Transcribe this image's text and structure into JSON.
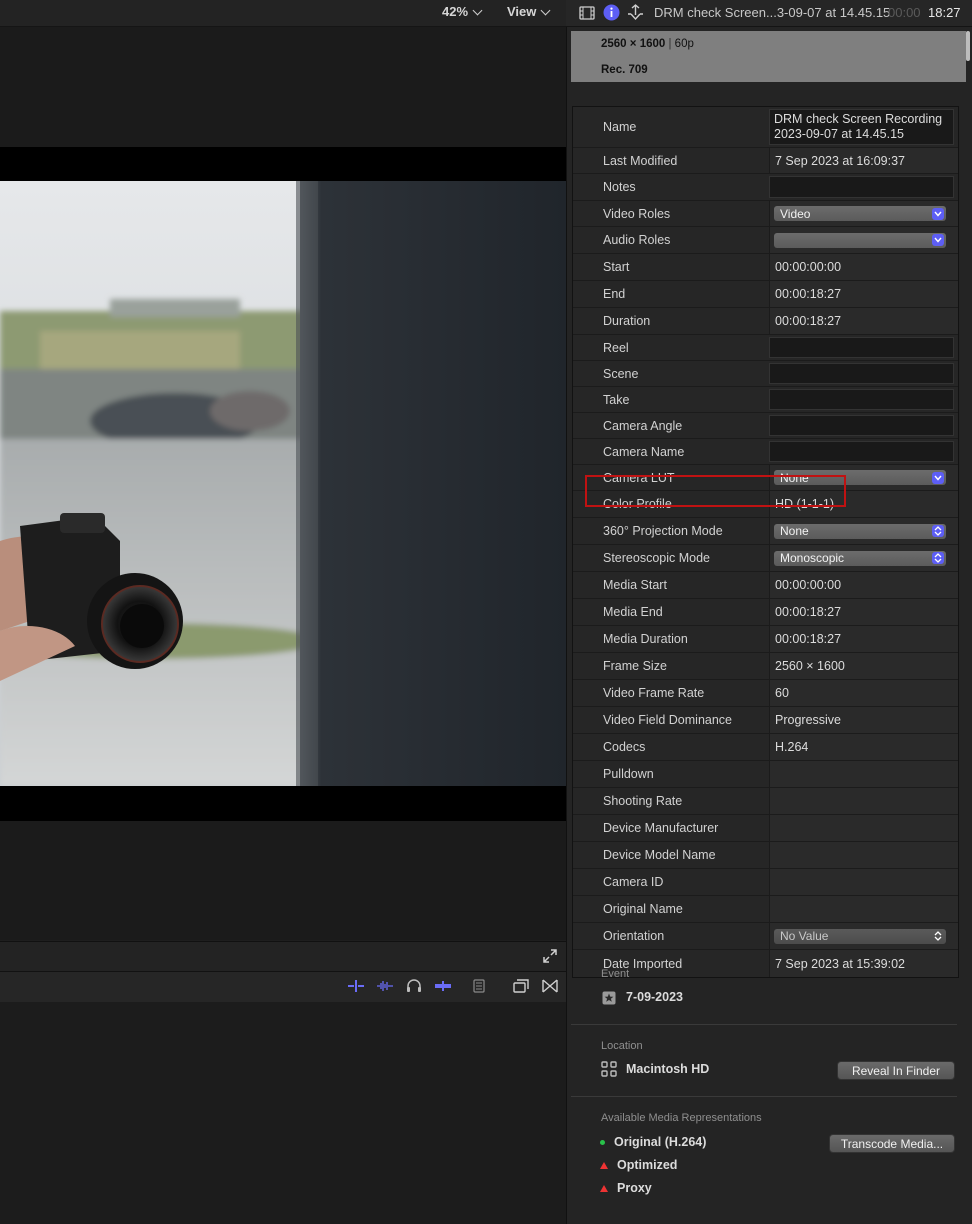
{
  "viewer": {
    "zoom_label": "42%",
    "view_label": "View"
  },
  "inspector": {
    "clip_title": "DRM check Screen...3-09-07 at 14.45.15",
    "timecode_dim": "00:00",
    "timecode": "18:27",
    "summary": {
      "resolution": "2560 × 1600",
      "fps": "60p",
      "color_space": "Rec. 709"
    },
    "rows": [
      {
        "label": "Name",
        "value": "DRM check Screen Recording 2023-09-07 at 14.45.15",
        "kind": "field"
      },
      {
        "label": "Last Modified",
        "value": "7 Sep 2023 at 16:09:37",
        "kind": "text"
      },
      {
        "label": "Notes",
        "value": "",
        "kind": "field"
      },
      {
        "label": "Video Roles",
        "value": "Video",
        "kind": "popup"
      },
      {
        "label": "Audio Roles",
        "value": "",
        "kind": "popup"
      },
      {
        "label": "Start",
        "value": "00:00:00:00",
        "kind": "text"
      },
      {
        "label": "End",
        "value": "00:00:18:27",
        "kind": "text"
      },
      {
        "label": "Duration",
        "value": "00:00:18:27",
        "kind": "text"
      },
      {
        "label": "Reel",
        "value": "",
        "kind": "field"
      },
      {
        "label": "Scene",
        "value": "",
        "kind": "field"
      },
      {
        "label": "Take",
        "value": "",
        "kind": "field"
      },
      {
        "label": "Camera Angle",
        "value": "",
        "kind": "field"
      },
      {
        "label": "Camera Name",
        "value": "",
        "kind": "field"
      },
      {
        "label": "Camera LUT",
        "value": "None",
        "kind": "popup"
      },
      {
        "label": "Color Profile",
        "value": "HD (1-1-1)",
        "kind": "text"
      },
      {
        "label": "360° Projection Mode",
        "value": "None",
        "kind": "popup"
      },
      {
        "label": "Stereoscopic Mode",
        "value": "Monoscopic",
        "kind": "popup"
      },
      {
        "label": "Media Start",
        "value": "00:00:00:00",
        "kind": "text"
      },
      {
        "label": "Media End",
        "value": "00:00:18:27",
        "kind": "text"
      },
      {
        "label": "Media Duration",
        "value": "00:00:18:27",
        "kind": "text"
      },
      {
        "label": "Frame Size",
        "value": "2560 × 1600",
        "kind": "text"
      },
      {
        "label": "Video Frame Rate",
        "value": "60",
        "kind": "text"
      },
      {
        "label": "Video Field Dominance",
        "value": "Progressive",
        "kind": "text"
      },
      {
        "label": "Codecs",
        "value": "H.264",
        "kind": "text"
      },
      {
        "label": "Pulldown",
        "value": "",
        "kind": "text"
      },
      {
        "label": "Shooting Rate",
        "value": "",
        "kind": "text"
      },
      {
        "label": "Device Manufacturer",
        "value": "",
        "kind": "text"
      },
      {
        "label": "Device Model Name",
        "value": "",
        "kind": "text"
      },
      {
        "label": "Camera ID",
        "value": "",
        "kind": "text"
      },
      {
        "label": "Original Name",
        "value": "",
        "kind": "text"
      },
      {
        "label": "Orientation",
        "value": "No Value",
        "kind": "popup-dim"
      },
      {
        "label": "Date Imported",
        "value": "7 Sep 2023 at 15:39:02",
        "kind": "text"
      }
    ],
    "event": {
      "label": "Event",
      "value": "7-09-2023"
    },
    "location": {
      "label": "Location",
      "value": "Macintosh HD",
      "button": "Reveal In Finder"
    },
    "media": {
      "label": "Available Media Representations",
      "button": "Transcode Media...",
      "items": [
        {
          "name": "Original (H.264)",
          "status": "available"
        },
        {
          "name": "Optimized",
          "status": "missing"
        },
        {
          "name": "Proxy",
          "status": "missing"
        }
      ]
    },
    "colors": {
      "accent": "#5d5ef5",
      "highlight": "#c01212",
      "available": "#29c24a",
      "missing": "#ee3333"
    }
  }
}
